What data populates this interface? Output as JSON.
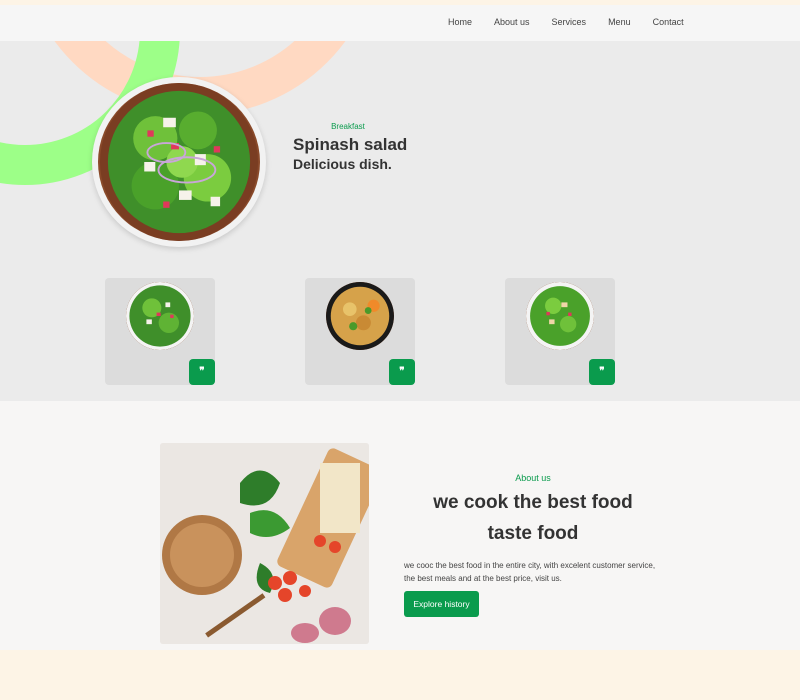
{
  "nav": {
    "items": [
      "Home",
      "About us",
      "Services",
      "Menu",
      "Contact"
    ]
  },
  "hero": {
    "kicker": "Breakfast",
    "title": "Spinash salad",
    "subtitle": "Delicious dish."
  },
  "cards": [
    {
      "button_glyph": "❞"
    },
    {
      "button_glyph": "❞"
    },
    {
      "button_glyph": "❞"
    }
  ],
  "about": {
    "kicker": "About us",
    "title_line1": "we cook the best food",
    "title_line2": "taste food",
    "paragraph": "we cooc the best food in the entire city, with excelent customer service, the best meals and at the best price, visit us.",
    "button_label": "Explore history"
  },
  "colors": {
    "accent": "#0a9b4d",
    "arc_orange": "#ffd9c2",
    "arc_green": "#9dff88",
    "card_bg": "#dcdcdc"
  },
  "icons": {
    "card_button": "quote-icon"
  }
}
